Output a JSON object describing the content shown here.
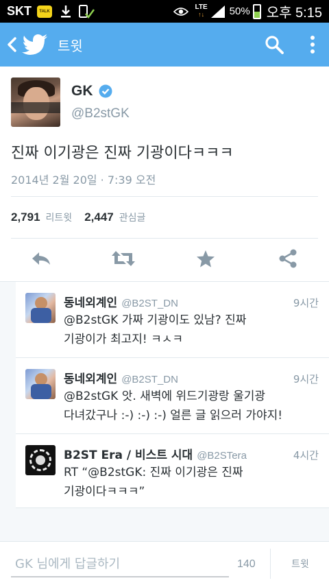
{
  "status_bar": {
    "carrier": "SKT",
    "talk_badge": "TALK",
    "network": "LTE",
    "battery": "50%",
    "battery_level": 0.5,
    "time": "오후 5:15"
  },
  "action_bar": {
    "title": "트윗",
    "icons": [
      "back-icon",
      "twitter-bird-icon",
      "search-icon",
      "overflow-icon"
    ],
    "color": "#55acee"
  },
  "tweet": {
    "name": "GK",
    "handle": "@B2stGK",
    "text": "진짜 이기광은 진짜 기광이다ㅋㅋㅋ",
    "timestamp": "2014년 2월 20일 · 7:39 오전",
    "retweet_count": "2,791",
    "retweet_label": "리트윗",
    "favorite_count": "2,447",
    "favorite_label": "관심글",
    "actions": [
      "reply-icon",
      "retweet-icon",
      "favorite-icon",
      "share-icon"
    ]
  },
  "replies": [
    {
      "name": "동네외계인",
      "handle": "@B2ST_DN",
      "time": "9시간",
      "line1": "@B2stGK 가짜 기광이도 있남? 진짜",
      "line2": "기광이가 최고지! ㅋㅅㅋ"
    },
    {
      "name": "동네외계인",
      "handle": "@B2ST_DN",
      "time": "9시간",
      "line1": "@B2stGK 앗. 새벽에 위드기광랑 울기광",
      "line2": "다녀갔구나 :-) :-) :-) 얼른 글 읽으러 가야지!"
    },
    {
      "name": "B2ST Era / 비스트 시대",
      "handle": "@B2STera",
      "time": "4시간",
      "line1": "RT “@B2stGK: 진짜 이기광은 진짜",
      "line2": "기광이다ㅋㅋㅋ”"
    }
  ],
  "compose": {
    "placeholder": "GK 님에게 답글하기",
    "char_count": "140",
    "tweet_button": "트윗"
  }
}
